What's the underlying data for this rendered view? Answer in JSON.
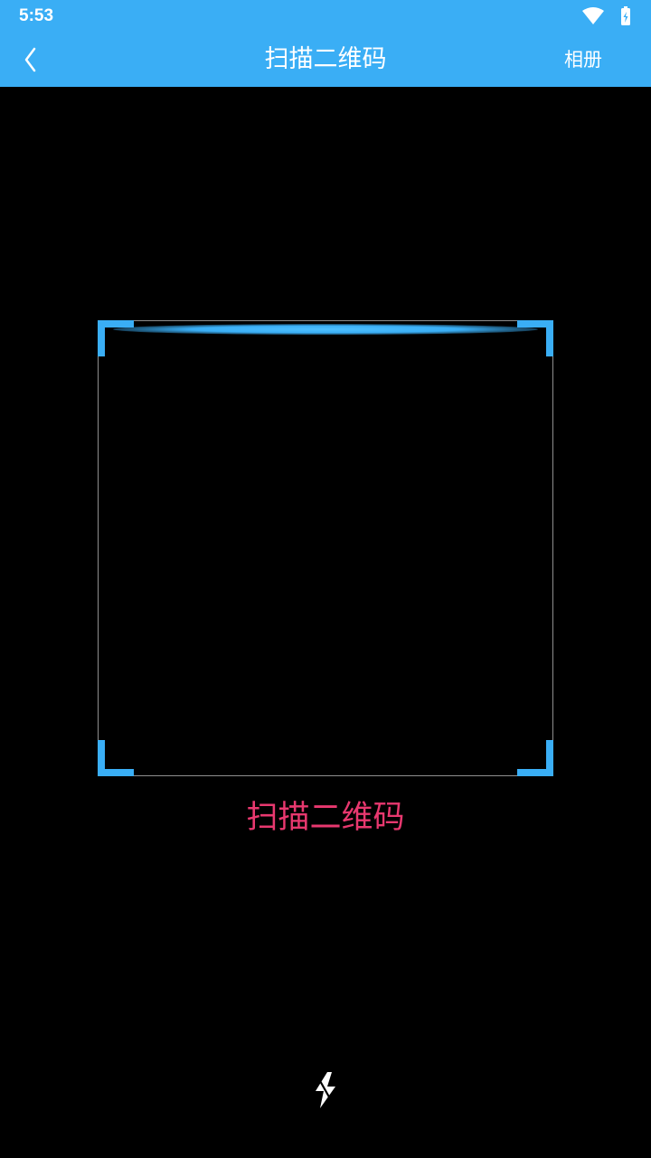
{
  "status_bar": {
    "time": "5:53",
    "icons": [
      "wifi-icon",
      "battery-charging-icon"
    ]
  },
  "header": {
    "back_icon": "chevron-left-icon",
    "title": "扫描二维码",
    "album_label": "相册",
    "background_color": "#3aaef5"
  },
  "scanner": {
    "hint": "扫描二维码",
    "hint_color": "#e8386f",
    "frame_accent_color": "#3aaef5",
    "flash_icon": "flash-off-icon"
  }
}
